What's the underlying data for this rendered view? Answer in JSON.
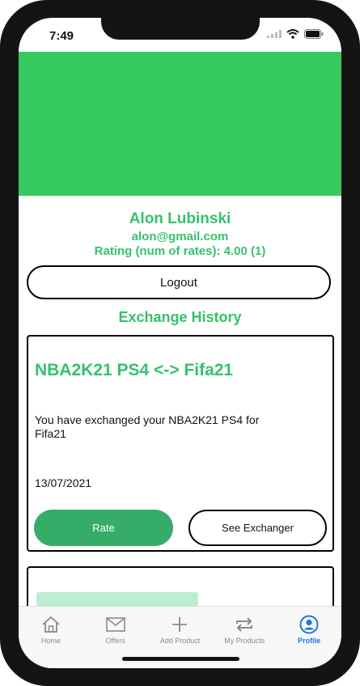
{
  "status_bar": {
    "time": "7:49"
  },
  "profile": {
    "name": "Alon Lubinski",
    "email": "alon@gmail.com",
    "rating": "Rating (num of rates): 4.00 (1)"
  },
  "logout_label": "Logout",
  "exchange_history": {
    "title": "Exchange History",
    "items": [
      {
        "title": "NBA2K21 PS4 <-> Fifa21",
        "description": "You have exchanged your NBA2K21 PS4 for Fifa21",
        "date": "13/07/2021",
        "rate_label": "Rate",
        "see_exchanger_label": "See Exchanger"
      }
    ]
  },
  "tabs": [
    {
      "label": "Home",
      "icon": "home-icon"
    },
    {
      "label": "Offers",
      "icon": "envelope-icon"
    },
    {
      "label": "Add Product",
      "icon": "plus-icon"
    },
    {
      "label": "My Products",
      "icon": "swap-icon"
    },
    {
      "label": "Profile",
      "icon": "profile-icon",
      "active": true
    }
  ],
  "colors": {
    "brand_green": "#35c95e",
    "text_green": "#35c26a",
    "button_green": "#35ad68",
    "active_blue": "#1877e5"
  }
}
